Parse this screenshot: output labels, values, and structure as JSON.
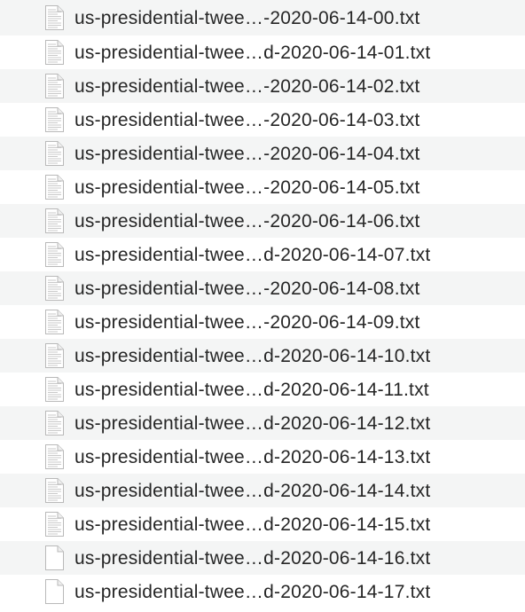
{
  "files": [
    {
      "name": "us-presidential-twee…-2020-06-14-00.txt",
      "icon": "text-document-icon"
    },
    {
      "name": "us-presidential-twee…d-2020-06-14-01.txt",
      "icon": "text-document-icon"
    },
    {
      "name": "us-presidential-twee…-2020-06-14-02.txt",
      "icon": "text-document-icon"
    },
    {
      "name": "us-presidential-twee…-2020-06-14-03.txt",
      "icon": "text-document-icon"
    },
    {
      "name": "us-presidential-twee…-2020-06-14-04.txt",
      "icon": "text-document-icon"
    },
    {
      "name": "us-presidential-twee…-2020-06-14-05.txt",
      "icon": "text-document-icon"
    },
    {
      "name": "us-presidential-twee…-2020-06-14-06.txt",
      "icon": "text-document-icon"
    },
    {
      "name": "us-presidential-twee…d-2020-06-14-07.txt",
      "icon": "text-document-icon"
    },
    {
      "name": "us-presidential-twee…-2020-06-14-08.txt",
      "icon": "text-document-icon"
    },
    {
      "name": "us-presidential-twee…-2020-06-14-09.txt",
      "icon": "text-document-icon"
    },
    {
      "name": "us-presidential-twee…d-2020-06-14-10.txt",
      "icon": "text-document-icon"
    },
    {
      "name": "us-presidential-twee…d-2020-06-14-11.txt",
      "icon": "text-document-icon"
    },
    {
      "name": "us-presidential-twee…d-2020-06-14-12.txt",
      "icon": "text-document-icon"
    },
    {
      "name": "us-presidential-twee…d-2020-06-14-13.txt",
      "icon": "text-document-icon"
    },
    {
      "name": "us-presidential-twee…d-2020-06-14-14.txt",
      "icon": "text-document-icon"
    },
    {
      "name": "us-presidential-twee…d-2020-06-14-15.txt",
      "icon": "text-document-icon"
    },
    {
      "name": "us-presidential-twee…d-2020-06-14-16.txt",
      "icon": "blank-document-icon"
    },
    {
      "name": "us-presidential-twee…d-2020-06-14-17.txt",
      "icon": "blank-document-icon"
    }
  ]
}
